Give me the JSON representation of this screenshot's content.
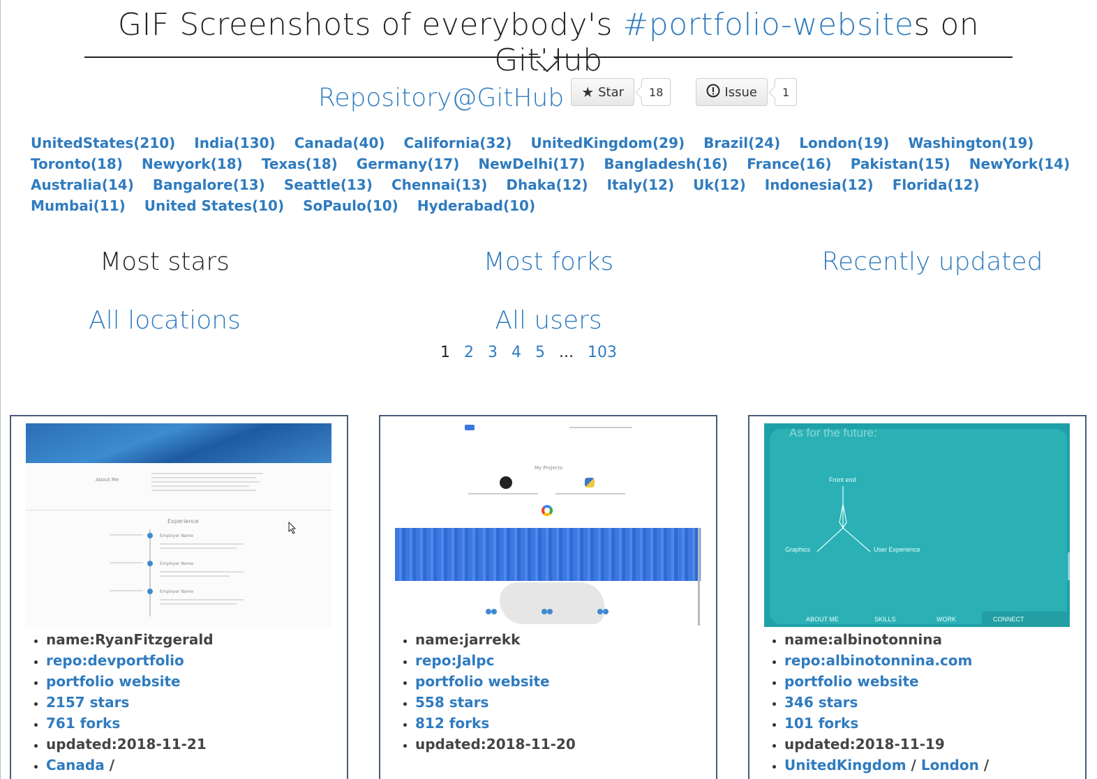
{
  "title": {
    "before": "GIF Screenshots of everybody's ",
    "highlight": "#portfolio-website",
    "after": "s on GitHub"
  },
  "repo": {
    "link": "Repository@GitHub",
    "star_label": "Star",
    "star_count": "18",
    "issue_label": "Issue",
    "issue_count": "1"
  },
  "locations": [
    "UnitedStates(210)",
    "India(130)",
    "Canada(40)",
    "California(32)",
    "UnitedKingdom(29)",
    "Brazil(24)",
    "London(19)",
    "Washington(19)",
    "Toronto(18)",
    "Newyork(18)",
    "Texas(18)",
    "Germany(17)",
    "NewDelhi(17)",
    "Bangladesh(16)",
    "France(16)",
    "Pakistan(15)",
    "NewYork(14)",
    "Australia(14)",
    "Bangalore(13)",
    "Seattle(13)",
    "Chennai(13)",
    "Dhaka(12)",
    "Italy(12)",
    "Uk(12)",
    "Indonesia(12)",
    "Florida(12)",
    "Mumbai(11)",
    "United States(10)",
    "SoPaulo(10)",
    "Hyderabad(10)"
  ],
  "sort": {
    "most_stars": "Most stars",
    "most_forks": "Most forks",
    "recently_updated": "Recently updated",
    "all_locations": "All locations",
    "all_users": "All users"
  },
  "pager": {
    "current": "1",
    "pages": [
      "2",
      "3",
      "4",
      "5"
    ],
    "dots": "...",
    "last": "103"
  },
  "cards": [
    {
      "name": "name:RyanFitzgerald",
      "repo": "repo:devportfolio",
      "type": "portfolio website",
      "stars": "2157 stars",
      "forks": "761 forks",
      "updated": "updated:2018-11-21",
      "location": "Canada",
      "location_sep": " /"
    },
    {
      "name": "name:jarrekk",
      "repo": "repo:Jalpc",
      "type": "portfolio website",
      "stars": "558 stars",
      "forks": "812 forks",
      "updated": "updated:2018-11-20"
    },
    {
      "name": "name:albinotonnina",
      "repo": "repo:albinotonnina.com",
      "type": "portfolio website",
      "stars": "346 stars",
      "forks": "101 forks",
      "updated": "updated:2018-11-19",
      "location": "UnitedKingdom",
      "location_sep": " / ",
      "location2": "London",
      "location_sep2": " /"
    }
  ],
  "shot1": {
    "about": "About Me",
    "experience": "Experience",
    "employer": "Employer Name"
  },
  "shot2": {
    "projects": "My Projects"
  },
  "shot3": {
    "heading": "As for the future:",
    "frontend": "Front end",
    "graphics": "Graphics",
    "ux": "User Experience",
    "nav": [
      "ABOUT ME",
      "SKILLS",
      "WORK",
      "CONNECT"
    ]
  },
  "colors": {
    "link": "#2f7bbf",
    "text": "#222222",
    "card_border": "#4a5a7a",
    "teal": "#2bb0b5"
  }
}
